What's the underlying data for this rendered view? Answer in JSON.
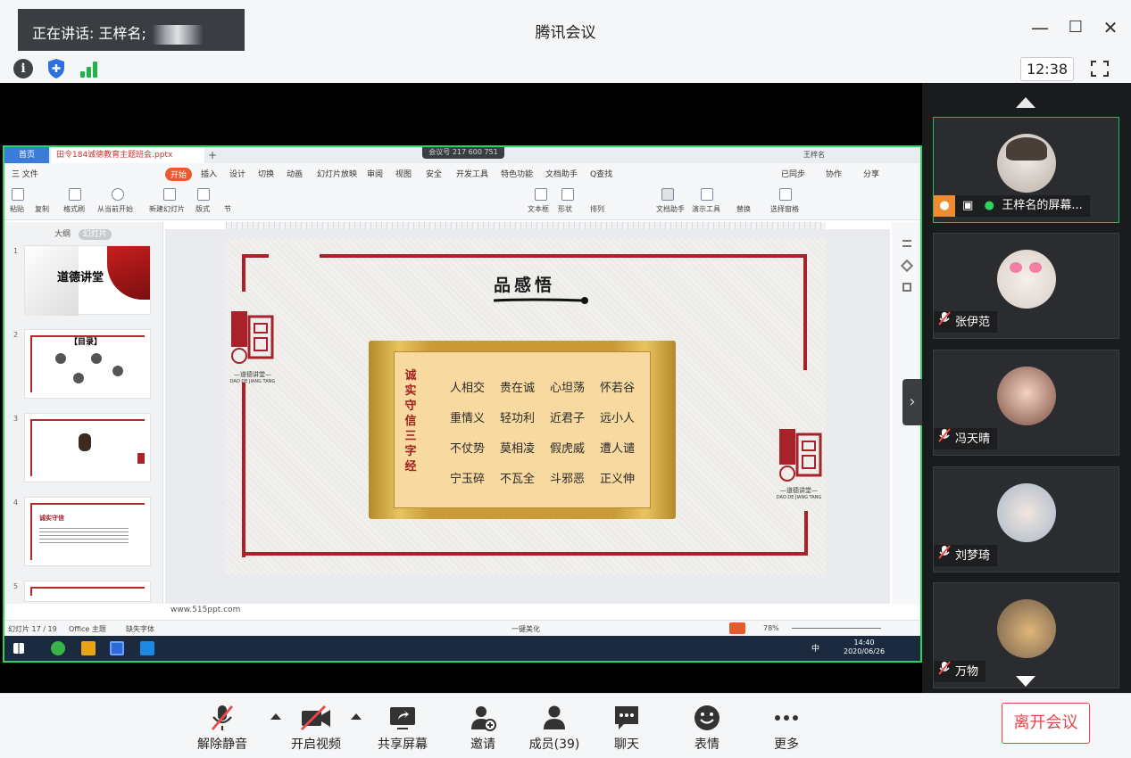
{
  "header": {
    "speaking_label": "正在讲话: 王梓名;",
    "app_title": "腾讯会议",
    "clock": "12:38"
  },
  "shared_screen": {
    "meeting_id": "会议号 217 600 751",
    "tabs": {
      "home": "首页",
      "document": "田令184诚德教育主题班会.pptx",
      "user": "王梓名"
    },
    "menu": [
      "三 文件",
      "开始",
      "插入",
      "设计",
      "切换",
      "动画",
      "幻灯片放映",
      "审阅",
      "视图",
      "安全",
      "开发工具",
      "特色功能",
      "文档助手",
      "Q查找"
    ],
    "menu_right": [
      "已同步",
      "协作",
      "分享"
    ],
    "ribbon": [
      "粘贴",
      "复制",
      "格式刷",
      "从当前开始",
      "新建幻灯片",
      "版式",
      "节",
      "文本框",
      "形状",
      "排列",
      "文档助手",
      "演示工具",
      "替换",
      "选择窗格"
    ],
    "thumb_tabs": {
      "outline": "大纲",
      "slides": "幻灯片"
    },
    "thumbs": [
      {
        "num": "1",
        "title": "道德讲堂"
      },
      {
        "num": "2",
        "title": "【目录】"
      },
      {
        "num": "3",
        "title": ""
      },
      {
        "num": "4",
        "title": "诚实守信"
      },
      {
        "num": "5",
        "title": ""
      }
    ],
    "slide": {
      "title": "品感悟",
      "vertical_title": "诚实守信三字经",
      "seal_caption": "—道德讲堂—",
      "seal_pinyin": "DAO DE JIANG TANG",
      "lines": [
        [
          "人相交",
          "贵在诚",
          "心坦荡",
          "怀若谷"
        ],
        [
          "重情义",
          "轻功利",
          "近君子",
          "远小人"
        ],
        [
          "不仗势",
          "莫相凌",
          "假虎威",
          "遭人谴"
        ],
        [
          "宁玉碎",
          "不瓦全",
          "斗邪恶",
          "正义伸"
        ]
      ]
    },
    "url": "www.515ppt.com",
    "status": {
      "slide_counter": "幻灯片 17 / 19",
      "theme": "Office 主题",
      "missing_font": "缺失字体",
      "beautify": "一键美化",
      "zoom": "78%"
    },
    "taskbar": {
      "time": "14:40",
      "date": "2020/06/26",
      "ime": "中"
    }
  },
  "participants": [
    {
      "name": "王梓名的屏幕...",
      "state": "sharing"
    },
    {
      "name": "张伊范",
      "state": "muted"
    },
    {
      "name": "冯天晴",
      "state": "muted"
    },
    {
      "name": "刘梦琦",
      "state": "muted"
    },
    {
      "name": "万物",
      "state": "muted"
    }
  ],
  "toolbar": {
    "unmute": "解除静音",
    "start_video": "开启视频",
    "share_screen": "共享屏幕",
    "invite": "邀请",
    "members": "成员(39)",
    "chat": "聊天",
    "reactions": "表情",
    "more": "更多",
    "leave": "离开会议"
  },
  "colors": {
    "accent_green": "#26b85b",
    "leave_red": "#e9434a",
    "slide_red": "#a8222a"
  }
}
